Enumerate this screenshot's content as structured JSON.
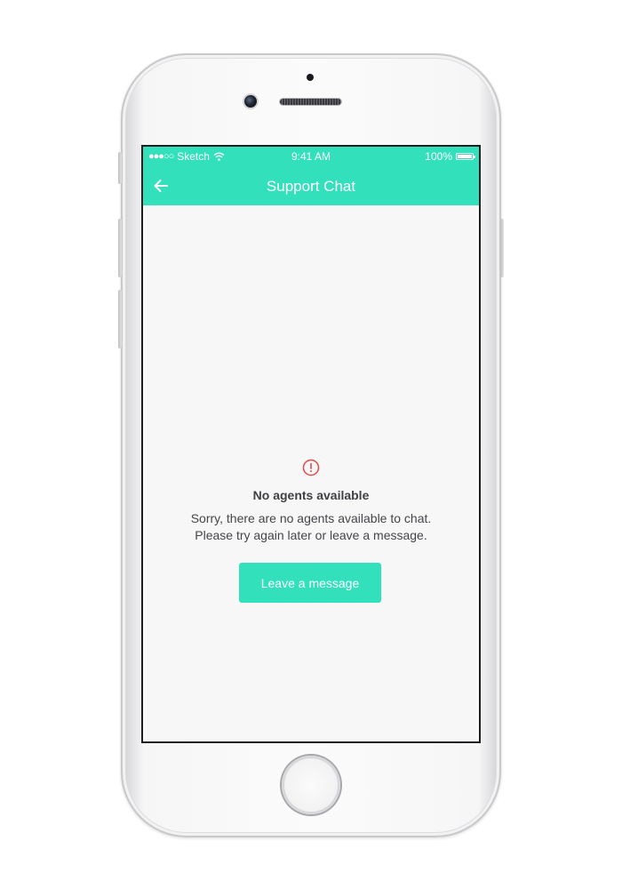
{
  "status_bar": {
    "carrier": "Sketch",
    "time": "9:41 AM",
    "battery": "100%"
  },
  "nav": {
    "title": "Support Chat",
    "back_icon": "arrow-left-icon"
  },
  "empty_state": {
    "icon": "alert-circle-icon",
    "title": "No agents available",
    "message_line1": "Sorry, there are no agents available to chat.",
    "message_line2": "Please try again later or leave a message.",
    "button_label": "Leave a message"
  },
  "colors": {
    "accent": "#33e0bc",
    "error": "#e5484d",
    "background": "#f7f7f7",
    "text": "#3f3f44"
  }
}
